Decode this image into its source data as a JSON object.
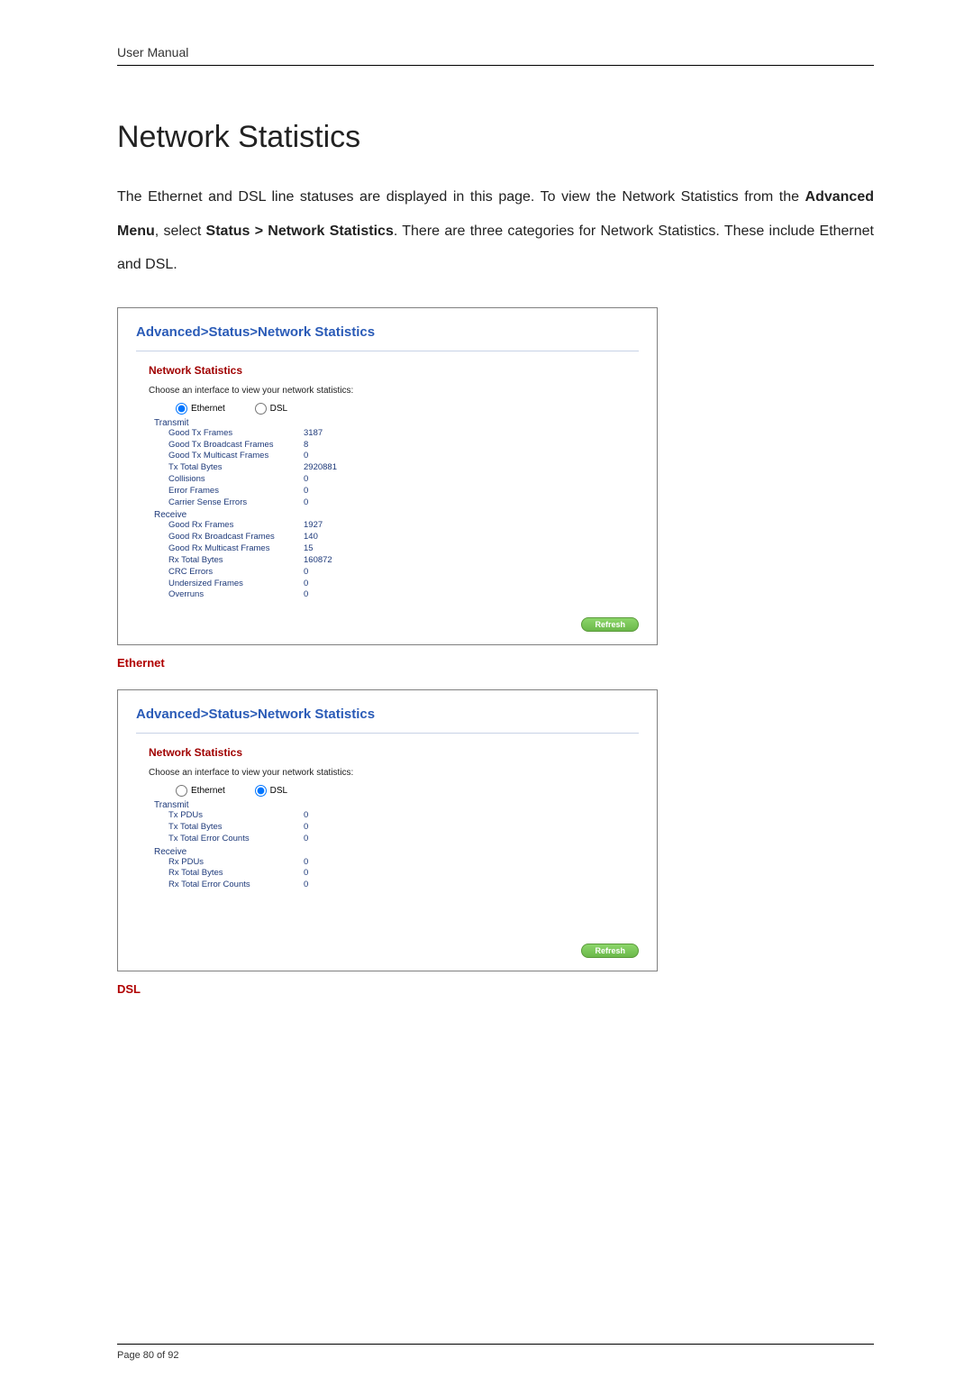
{
  "header": {
    "label": "User Manual"
  },
  "title": "Network Statistics",
  "intro_parts": {
    "p1": "The Ethernet and DSL line statuses are displayed in this page. To view the Network Statistics from the ",
    "b1": "Advanced Menu",
    "p2": ", select ",
    "b2": "Status > Network Statistics",
    "p3": ". There are three categories for Network Statistics. These include Ethernet and DSL."
  },
  "panel_common": {
    "header": "Advanced>Status>Network Statistics",
    "sub_title": "Network Statistics",
    "prompt": "Choose an interface to view your network statistics:",
    "radio_ethernet": "Ethernet",
    "radio_dsl": "DSL",
    "refresh": "Refresh",
    "section_transmit": "Transmit",
    "section_receive": "Receive"
  },
  "panel1": {
    "selected": "ethernet",
    "transmit": [
      {
        "label": "Good Tx Frames",
        "value": "3187"
      },
      {
        "label": "Good Tx Broadcast Frames",
        "value": "8"
      },
      {
        "label": "Good Tx Multicast Frames",
        "value": "0"
      },
      {
        "label": "Tx Total Bytes",
        "value": "2920881"
      },
      {
        "label": "Collisions",
        "value": "0"
      },
      {
        "label": "Error Frames",
        "value": "0"
      },
      {
        "label": "Carrier Sense Errors",
        "value": "0"
      }
    ],
    "receive": [
      {
        "label": "Good Rx Frames",
        "value": "1927"
      },
      {
        "label": "Good Rx Broadcast Frames",
        "value": "140"
      },
      {
        "label": "Good Rx Multicast Frames",
        "value": "15"
      },
      {
        "label": "Rx Total Bytes",
        "value": "160872"
      },
      {
        "label": "CRC Errors",
        "value": "0"
      },
      {
        "label": "Undersized Frames",
        "value": "0"
      },
      {
        "label": "Overruns",
        "value": "0"
      }
    ]
  },
  "caption1": "Ethernet",
  "panel2": {
    "selected": "dsl",
    "transmit": [
      {
        "label": "Tx PDUs",
        "value": "0"
      },
      {
        "label": "Tx Total Bytes",
        "value": "0"
      },
      {
        "label": "Tx Total Error Counts",
        "value": "0"
      }
    ],
    "receive": [
      {
        "label": "Rx PDUs",
        "value": "0"
      },
      {
        "label": "Rx Total Bytes",
        "value": "0"
      },
      {
        "label": "Rx Total Error Counts",
        "value": "0"
      }
    ]
  },
  "caption2": "DSL",
  "footer": {
    "page": "Page 80 of 92"
  }
}
